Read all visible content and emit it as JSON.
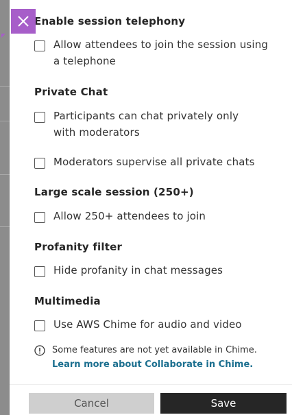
{
  "sections": [
    {
      "title": "Enable session telephony",
      "options": [
        {
          "label": "Allow attendees to join the session using a telephone",
          "checked": false
        }
      ]
    },
    {
      "title": "Private Chat",
      "options": [
        {
          "label": "Participants can chat privately only with moderators",
          "checked": false
        },
        {
          "label": "Moderators supervise all private chats",
          "checked": false
        }
      ]
    },
    {
      "title": "Large scale session (250+)",
      "options": [
        {
          "label": "Allow 250+ attendees to join",
          "checked": false
        }
      ]
    },
    {
      "title": "Profanity filter",
      "options": [
        {
          "label": "Hide profanity in chat messages",
          "checked": false
        }
      ]
    },
    {
      "title": "Multimedia",
      "options": [
        {
          "label": "Use AWS Chime for audio and video",
          "checked": false
        }
      ]
    }
  ],
  "info": {
    "text": "Some features are not yet available in Chime. ",
    "link": "Learn more about Collaborate in Chime."
  },
  "footer": {
    "cancel_label": "Cancel",
    "save_label": "Save"
  },
  "colors": {
    "accent": "#a75ec9",
    "link": "#1b6f8f",
    "save_bg": "#262626",
    "cancel_bg": "#cfcfcf"
  }
}
